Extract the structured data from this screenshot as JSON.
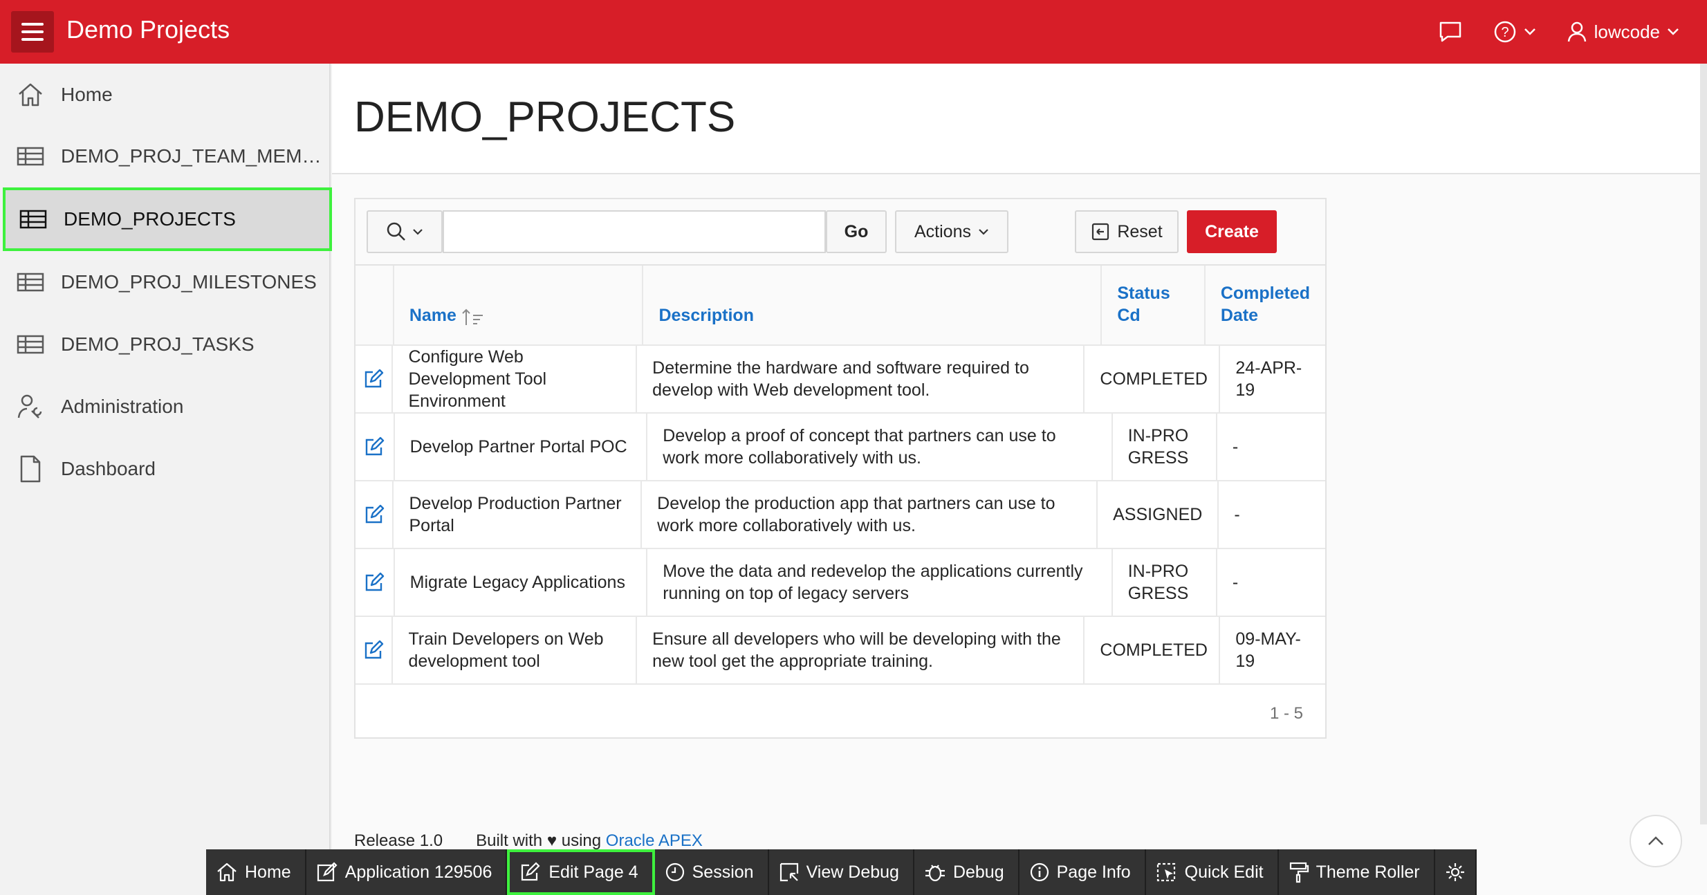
{
  "header": {
    "app_title": "Demo Projects",
    "user_name": "lowcode",
    "icons": {
      "menu": "hamburger-icon",
      "feedback": "chat-bubble-icon",
      "help": "help-icon",
      "user": "user-icon"
    },
    "brand_color": "#d71e28"
  },
  "sidebar": {
    "items": [
      {
        "label": "Home",
        "icon": "home-icon"
      },
      {
        "label": "DEMO_PROJ_TEAM_MEMBERS",
        "icon": "table-icon"
      },
      {
        "label": "DEMO_PROJECTS",
        "icon": "table-icon",
        "active": true
      },
      {
        "label": "DEMO_PROJ_MILESTONES",
        "icon": "table-icon"
      },
      {
        "label": "DEMO_PROJ_TASKS",
        "icon": "table-icon"
      },
      {
        "label": "Administration",
        "icon": "user-wrench-icon"
      },
      {
        "label": "Dashboard",
        "icon": "file-icon"
      }
    ]
  },
  "main": {
    "page_title": "DEMO_PROJECTS",
    "toolbar": {
      "search_value": "",
      "go_label": "Go",
      "actions_label": "Actions",
      "reset_label": "Reset",
      "create_label": "Create"
    },
    "table": {
      "columns": [
        "Name",
        "Description",
        "Status Cd",
        "Completed Date"
      ],
      "rows": [
        {
          "name": "Configure Web Development Tool Environment",
          "description": "Determine the hardware and software required to develop with Web development tool.",
          "status": "COMPLETED",
          "date": "24-APR-19"
        },
        {
          "name": "Develop Partner Portal POC",
          "description": "Develop a proof of concept that partners can use to work more collaboratively with us.",
          "status": "IN-PROGRESS",
          "date": "-"
        },
        {
          "name": "Develop Production Partner Portal",
          "description": "Develop the production app that partners can use to work more collaboratively with us.",
          "status": "ASSIGNED",
          "date": "-"
        },
        {
          "name": "Migrate Legacy Applications",
          "description": "Move the data and redevelop the applications currently running on top of legacy servers",
          "status": "IN-PROGRESS",
          "date": "-"
        },
        {
          "name": "Train Developers on Web development tool",
          "description": "Ensure all developers who will be developing with the new tool get the appropriate training.",
          "status": "COMPLETED",
          "date": "09-MAY-19"
        }
      ],
      "pagination": "1 - 5"
    },
    "footer": {
      "release": "Release 1.0",
      "built_prefix": "Built with",
      "built_using": "using",
      "apex_link": "Oracle APEX"
    }
  },
  "dev_toolbar": {
    "items": [
      {
        "label": "Home",
        "icon": "home-icon"
      },
      {
        "label": "Application 129506",
        "icon": "edit-app-icon"
      },
      {
        "label": "Edit Page 4",
        "icon": "edit-icon",
        "highlighted": true
      },
      {
        "label": "Session",
        "icon": "clock-icon"
      },
      {
        "label": "View Debug",
        "icon": "view-debug-icon"
      },
      {
        "label": "Debug",
        "icon": "bug-icon"
      },
      {
        "label": "Page Info",
        "icon": "info-icon"
      },
      {
        "label": "Quick Edit",
        "icon": "quick-edit-icon"
      },
      {
        "label": "Theme Roller",
        "icon": "paint-roller-icon"
      },
      {
        "label": "",
        "icon": "gear-icon"
      }
    ]
  }
}
